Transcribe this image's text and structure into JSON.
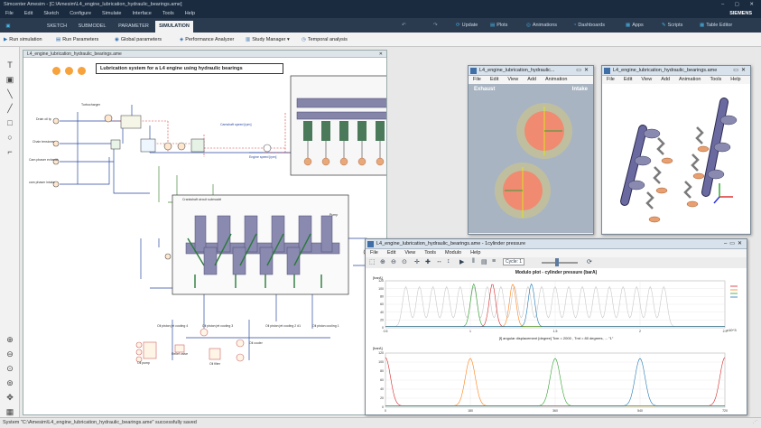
{
  "window": {
    "title": "Simcenter Amesim - [C:\\Amesim\\L4_engine_lubrication_hydraulic_bearings.ame]",
    "controls": "–  ▢  ✕"
  },
  "menu": {
    "items": [
      "File",
      "Edit",
      "Sketch",
      "Configure",
      "Simulate",
      "Interface",
      "Tools",
      "Help"
    ],
    "brand": "SIEMENS"
  },
  "ribbon": {
    "tabs": [
      "SKETCH",
      "SUBMODEL",
      "PARAMETER",
      "SIMULATION"
    ],
    "active_tab": "SIMULATION",
    "right_buttons": [
      "Update",
      "Plots",
      "Animations",
      "Dashboards",
      "Apps",
      "Scripts",
      "Table Editor"
    ]
  },
  "toolbar": {
    "buttons": [
      "Run simulation",
      "Run Parameters",
      "Global parameters",
      "Performance Analyzer",
      "Study Manager",
      "Temporal analysis"
    ]
  },
  "sketch": {
    "tab_title": "L4_engine_lubrication_hydraulic_bearings.ame",
    "heading": "Lubrication system for a L4 engine using hydraulic bearings",
    "inner_title": "L4_engine_lubrication_hydraulic_bearings.ame",
    "labels": {
      "turbocharger": "Turbocharger",
      "drain_oil": "Drain oil tp",
      "chain_tensioner": "Chain tensioner",
      "cam_phaser_exhaust": "Cam phaser exhaust",
      "cam_phaser_intake": "cam phaser intake",
      "camshaft_speed": "Camshaft speed [rpm]",
      "engine_speed": "Engine speed [rpm]",
      "pump": "Pump",
      "crank_sub": "Crankshaft circuit submodel",
      "oil_jet_1": "Oil piston jet cooling 4",
      "oil_jet_2": "Oil piston jet cooling 3",
      "oil_jet_3": "Oil piston jet cooling 2 #1",
      "oil_jet_4": "Oil piston cooling 1",
      "oil_pump": "Oil pump",
      "oil_filter": "Oil filter",
      "oil_cooler": "Oil cooler",
      "relief": "Relief valve"
    }
  },
  "valve_window": {
    "title": "L4_engine_lubrication_hydraulic...",
    "menu": [
      "File",
      "Edit",
      "View",
      "Add",
      "Animation"
    ],
    "exhaust": "Exhaust",
    "intake": "Intake"
  },
  "camshaft_window": {
    "title": "L4_engine_lubrication_hydraulic_bearings.ame",
    "menu": [
      "File",
      "Edit",
      "View",
      "Add",
      "Animation",
      "Tools",
      "Help"
    ]
  },
  "plot_window": {
    "title": "L4_engine_lubrication_hydraulic_bearings.ame - 1cylinder pressure",
    "menu": [
      "File",
      "Edit",
      "View",
      "Tools",
      "Modulo",
      "Help"
    ],
    "toolbar_value": "Cycle: 1",
    "top_title": "Modulo plot - cylinder pressure (barA)",
    "top_xlabel": "[f] angular displacement [degree] Tcm = 2000 , Tmt = 80 degrees, ... \"1\"",
    "top_unit": "[barA]",
    "x_suffix": "x10^3",
    "bottom_unit": "[barA]"
  },
  "chart_data": [
    {
      "type": "line",
      "title": "Modulo plot - cylinder pressure (barA)",
      "ylabel": "[barA]",
      "x_ticks": [
        0.5,
        1,
        1.5,
        2,
        2.5
      ],
      "xlim": [
        0.5,
        2.5
      ],
      "y_ticks": [
        0,
        20,
        40,
        60,
        80,
        100,
        120
      ],
      "ylim": [
        0,
        120
      ],
      "grid": true,
      "series": [
        {
          "color": "#c8c8c8",
          "peaks": [
            0.62,
            0.7,
            0.78,
            0.86,
            0.94,
            1.02,
            1.1,
            1.18,
            1.26,
            1.34,
            1.42,
            1.5,
            1.58,
            1.66,
            1.74,
            1.82,
            1.9,
            1.98,
            2.06,
            2.14
          ],
          "peak_value": 105
        },
        {
          "color": "#d62728",
          "peaks": [
            1.13
          ],
          "peak_value": 112
        },
        {
          "color": "#ff7f0e",
          "peaks": [
            1.25
          ],
          "peak_value": 112
        },
        {
          "color": "#2ca02c",
          "peaks": [
            1.02
          ],
          "peak_value": 112
        },
        {
          "color": "#1f77b4",
          "peaks": [
            1.36
          ],
          "peak_value": 112
        }
      ]
    },
    {
      "type": "line",
      "ylabel": "[barA]",
      "x_ticks": [
        0,
        180,
        360,
        540,
        720
      ],
      "xlim": [
        0,
        720
      ],
      "y_ticks": [
        0,
        20,
        40,
        60,
        80,
        100,
        120
      ],
      "ylim": [
        0,
        120
      ],
      "grid": true,
      "series": [
        {
          "color": "#d62728",
          "peaks": [
            0,
            720
          ],
          "peak_value": 110
        },
        {
          "color": "#ff7f0e",
          "peaks": [
            180
          ],
          "peak_value": 108
        },
        {
          "color": "#2ca02c",
          "peaks": [
            360
          ],
          "peak_value": 108
        },
        {
          "color": "#1f77b4",
          "peaks": [
            540
          ],
          "peak_value": 108
        }
      ]
    }
  ],
  "status": {
    "text": "System \"C:\\Amesim\\L4_engine_lubrication_hydraulic_bearings.ame\" successfully saved"
  }
}
